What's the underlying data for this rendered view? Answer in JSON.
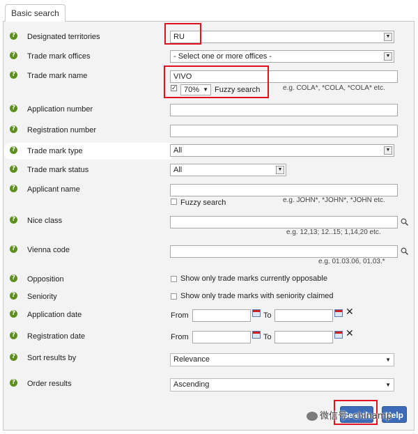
{
  "tab": {
    "label": "Basic search"
  },
  "rows": {
    "designated_territories": {
      "label": "Designated territories",
      "value": "RU"
    },
    "trade_mark_offices": {
      "label": "Trade mark offices",
      "value": "- Select one or more offices -"
    },
    "trade_mark_name": {
      "label": "Trade mark name",
      "value": "VIVO",
      "fuzzy_percent": "70%",
      "fuzzy_label": "Fuzzy search",
      "hint": "e.g. COLA*, *COLA, *COLA* etc."
    },
    "application_number": {
      "label": "Application number",
      "value": ""
    },
    "registration_number": {
      "label": "Registration number",
      "value": ""
    },
    "trade_mark_type": {
      "label": "Trade mark type",
      "value": "All"
    },
    "trade_mark_status": {
      "label": "Trade mark status",
      "value": "All"
    },
    "applicant_name": {
      "label": "Applicant name",
      "value": "",
      "fuzzy_label": "Fuzzy search",
      "hint": "e.g. JOHN*, *JOHN*, *JOHN etc."
    },
    "nice_class": {
      "label": "Nice class",
      "value": "",
      "hint": "e.g. 12,13; 12..15; 1,14,20 etc."
    },
    "vienna_code": {
      "label": "Vienna code",
      "value": "",
      "hint": "e.g. 01.03.06, 01.03.*"
    },
    "opposition": {
      "label": "Opposition",
      "checkbox_label": "Show only trade marks currently opposable"
    },
    "seniority": {
      "label": "Seniority",
      "checkbox_label": "Show only trade marks with seniority claimed"
    },
    "application_date": {
      "label": "Application date",
      "from": "From",
      "to": "To"
    },
    "registration_date": {
      "label": "Registration date",
      "from": "From",
      "to": "To"
    },
    "sort_results": {
      "label": "Sort results by",
      "value": "Relevance"
    },
    "order_results": {
      "label": "Order results",
      "value": "Ascending"
    }
  },
  "buttons": {
    "search": "Search",
    "help": "Help"
  },
  "watermark": "微信号: chinamp",
  "colors": {
    "help_icon": "#5c8f1e",
    "highlight": "#e0101e",
    "button": "#3d6bb8"
  }
}
